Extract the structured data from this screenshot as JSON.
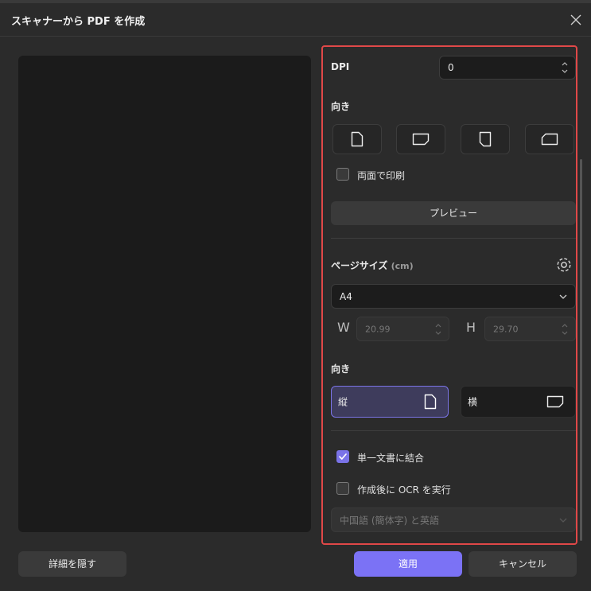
{
  "window": {
    "title": "スキャナーから PDF を作成"
  },
  "settings": {
    "dpi": {
      "label": "DPI",
      "value": "0"
    },
    "orientation_section": {
      "label": "向き",
      "buttons": [
        "portrait-icon",
        "landscape-icon",
        "portrait-right-icon",
        "landscape-left-icon"
      ]
    },
    "duplex": {
      "label": "両面で印刷",
      "checked": false
    },
    "preview_button": "プレビュー",
    "page_size": {
      "label": "ページサイズ",
      "unit": "(cm)",
      "selected": "A4",
      "width_letter": "W",
      "width_value": "20.99",
      "height_letter": "H",
      "height_value": "29.70"
    },
    "page_orientation": {
      "label": "向き",
      "portrait": "縦",
      "landscape": "横"
    },
    "combine": {
      "label": "単一文書に結合",
      "checked": true
    },
    "ocr": {
      "label": "作成後に OCR を実行",
      "checked": false
    },
    "ocr_language": "中国語 (簡体字) と英語"
  },
  "footer": {
    "hide_details": "詳細を隠す",
    "apply": "適用",
    "cancel": "キャンセル"
  },
  "colors": {
    "accent": "#7b72f5",
    "highlight_border": "#e04848"
  }
}
